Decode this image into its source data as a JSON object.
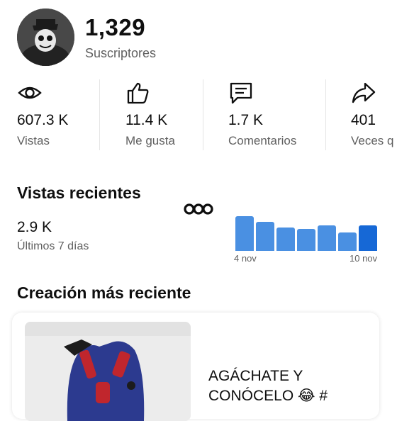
{
  "channel": {
    "subscribers_count": "1,329",
    "subscribers_label": "Suscriptores"
  },
  "stats": {
    "views": {
      "value": "607.3 K",
      "label": "Vistas",
      "icon": "eye-icon"
    },
    "likes": {
      "value": "11.4 K",
      "label": "Me gusta",
      "icon": "thumbs-up-icon"
    },
    "comments": {
      "value": "1.7 K",
      "label": "Comentarios",
      "icon": "comment-icon"
    },
    "shares": {
      "value": "401",
      "label": "Veces q",
      "icon": "share-icon"
    }
  },
  "recent_views": {
    "title": "Vistas recientes",
    "value": "2.9 K",
    "period": "Últimos 7 días",
    "start_date_label": "4 nov",
    "end_date_label": "10 nov",
    "daily_levels": [
      0.91,
      0.75,
      0.62,
      0.58,
      0.66,
      0.49,
      0.67
    ],
    "bar_color": "#4a90e2",
    "current_bar_color": "#1668d6"
  },
  "latest": {
    "title": "Creación más reciente",
    "video_title_line1": "AGÁCHATE Y",
    "video_title_line2": "CONÓCELO 😂 #"
  }
}
